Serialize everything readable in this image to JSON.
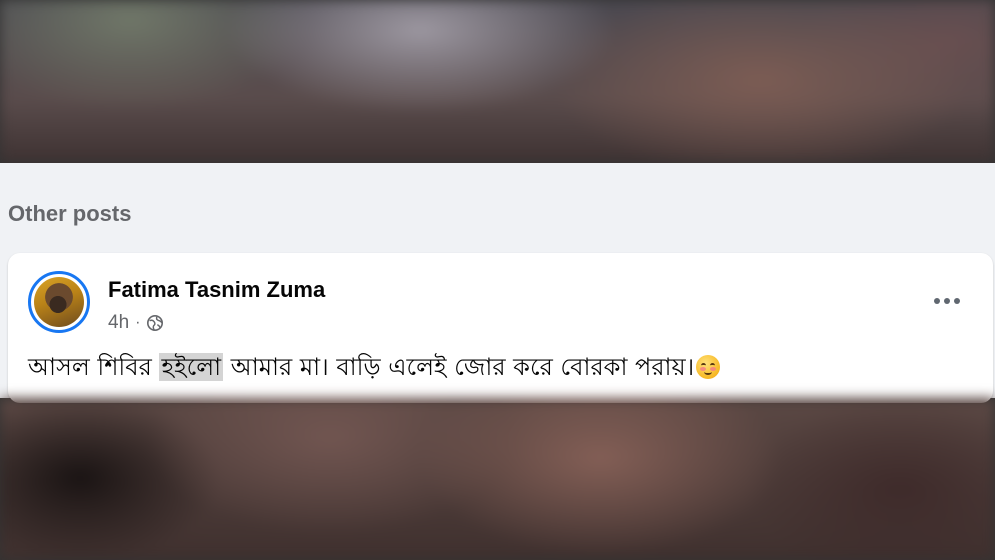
{
  "section": {
    "title": "Other posts"
  },
  "post": {
    "author": "Fatima Tasnim Zuma",
    "time": "4h",
    "separator": "·",
    "privacy_icon": "globe-icon",
    "text_before": "আসল শিবির ",
    "text_highlight": "হইলো",
    "text_after": " আমার মা। বাড়ি এলেই জোর করে বোরকা পরায়।",
    "emoji": "smiling-face-emoji",
    "more_icon": "more-options-icon"
  },
  "colors": {
    "panel_bg": "#f0f2f5",
    "card_bg": "#ffffff",
    "avatar_ring": "#1877f2",
    "secondary_text": "#65676b",
    "primary_text": "#050505",
    "highlight": "#d4d4d4"
  }
}
